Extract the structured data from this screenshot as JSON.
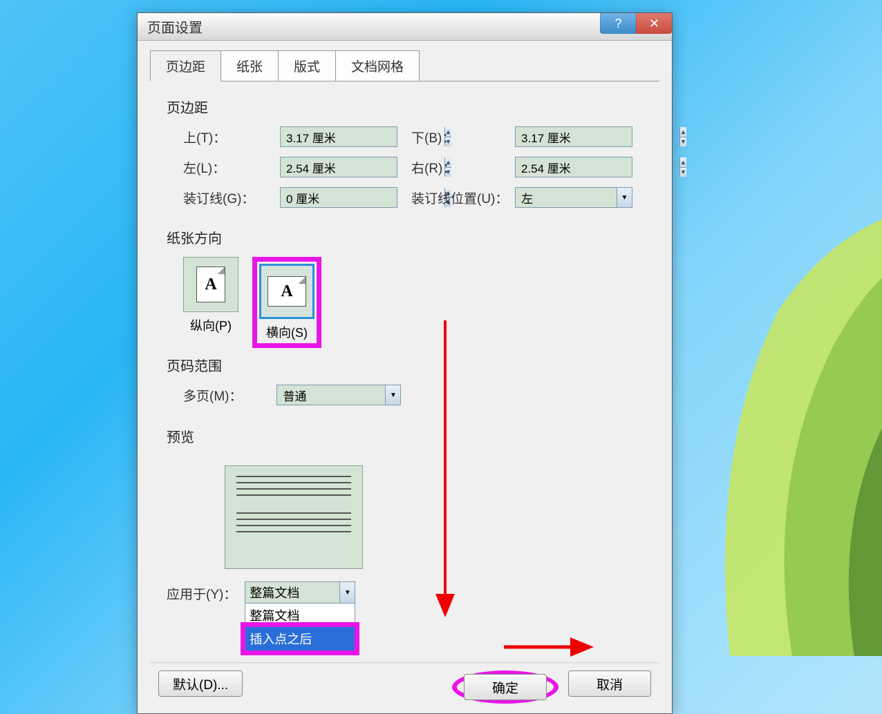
{
  "titlebar": {
    "title": "页面设置"
  },
  "tabs": {
    "margins": "页边距",
    "paper": "纸张",
    "layout": "版式",
    "grid": "文档网格"
  },
  "margins": {
    "section": "页边距",
    "top_label": "上(T)：",
    "top_value": "3.17 厘米",
    "bottom_label": "下(B)：",
    "bottom_value": "3.17 厘米",
    "left_label": "左(L)：",
    "left_value": "2.54 厘米",
    "right_label": "右(R)：",
    "right_value": "2.54 厘米",
    "gutter_label": "装订线(G)：",
    "gutter_value": "0 厘米",
    "gutter_pos_label": "装订线位置(U)：",
    "gutter_pos_value": "左"
  },
  "orientation": {
    "section": "纸张方向",
    "portrait": "纵向(P)",
    "landscape": "横向(S)",
    "icon_letter": "A"
  },
  "pages": {
    "section": "页码范围",
    "multi_label": "多页(M)：",
    "multi_value": "普通"
  },
  "preview": {
    "section": "预览"
  },
  "apply": {
    "label": "应用于(Y)：",
    "selected": "整篇文档",
    "opt1": "整篇文档",
    "opt2": "插入点之后"
  },
  "buttons": {
    "default": "默认(D)...",
    "ok": "确定",
    "cancel": "取消"
  }
}
